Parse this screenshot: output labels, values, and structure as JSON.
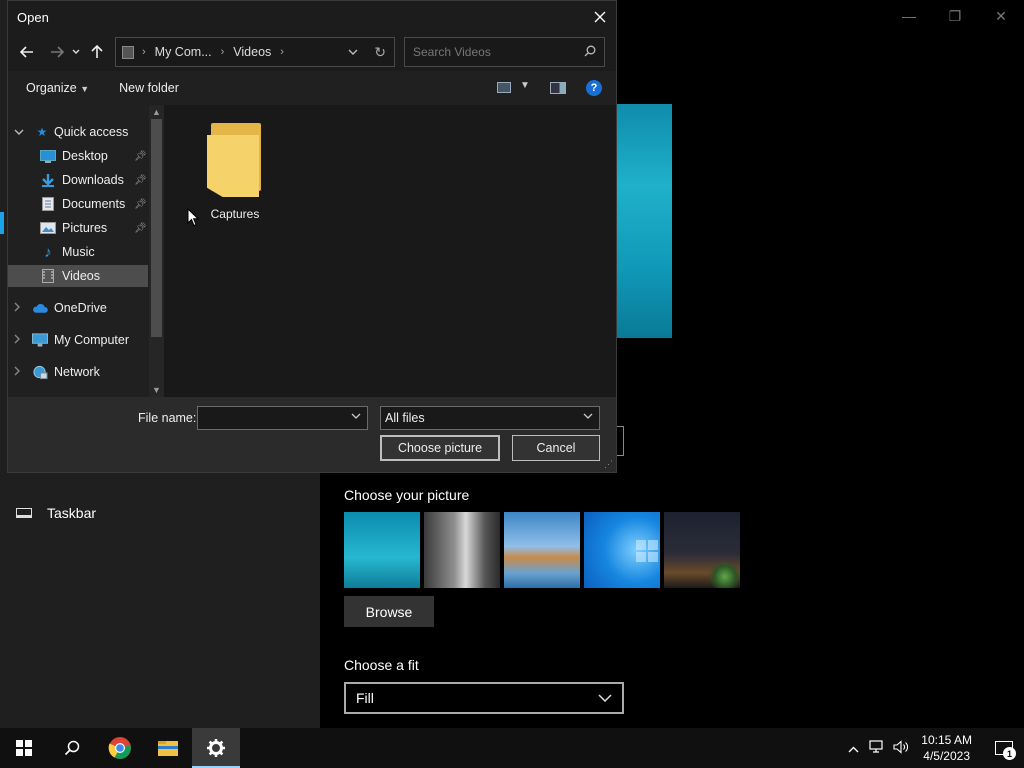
{
  "background": {
    "taskbar_nav_label": "Taskbar",
    "choose_picture_title": "Choose your picture",
    "browse_label": "Browse",
    "choose_fit_title": "Choose a fit",
    "fit_value": "Fill",
    "window_controls": [
      "minimize-icon",
      "restore-icon",
      "close-icon"
    ]
  },
  "dialog": {
    "title": "Open",
    "nav": {
      "back": "←",
      "forward": "→",
      "recent": "⌄",
      "up": "↑"
    },
    "address": {
      "segments": [
        "My Com...",
        "Videos"
      ]
    },
    "search": {
      "placeholder": "Search Videos"
    },
    "toolbar": {
      "organize": "Organize",
      "new_folder": "New folder",
      "help": "?"
    },
    "nav_pane": {
      "items": [
        {
          "label": "Quick access",
          "icon": "star-icon",
          "color": "#1a8fe3"
        },
        {
          "label": "Desktop",
          "icon": "desktop-icon",
          "pinned": true,
          "color": "#3a9ad9"
        },
        {
          "label": "Downloads",
          "icon": "download-icon",
          "pinned": true,
          "color": "#3a9ad9"
        },
        {
          "label": "Documents",
          "icon": "document-icon",
          "pinned": true,
          "color": "#cfcfcf"
        },
        {
          "label": "Pictures",
          "icon": "pictures-icon",
          "pinned": true,
          "color": "#8ab4d8"
        },
        {
          "label": "Music",
          "icon": "music-icon",
          "color": "#3a9ad9"
        },
        {
          "label": "Videos",
          "icon": "videos-icon",
          "selected": true,
          "color": "#aaaaaa"
        },
        {
          "label": "OneDrive",
          "icon": "cloud-icon",
          "color": "#2a8ae0"
        },
        {
          "label": "My Computer",
          "icon": "computer-icon",
          "color": "#3a9ad9"
        },
        {
          "label": "Network",
          "icon": "network-icon",
          "color": "#3a9ad9"
        }
      ]
    },
    "files": [
      {
        "name": "Captures",
        "type": "folder"
      }
    ],
    "footer": {
      "file_name_label": "File name:",
      "file_name_value": "",
      "file_type": "All files",
      "choose_button": "Choose picture",
      "cancel_button": "Cancel"
    }
  },
  "taskbar": {
    "apps": [
      "start-icon",
      "search-icon",
      "chrome-icon",
      "file-explorer-icon",
      "settings-icon"
    ],
    "active_app": "settings-icon",
    "clock_time": "10:15 AM",
    "clock_date": "4/5/2023",
    "notification_count": "1"
  }
}
